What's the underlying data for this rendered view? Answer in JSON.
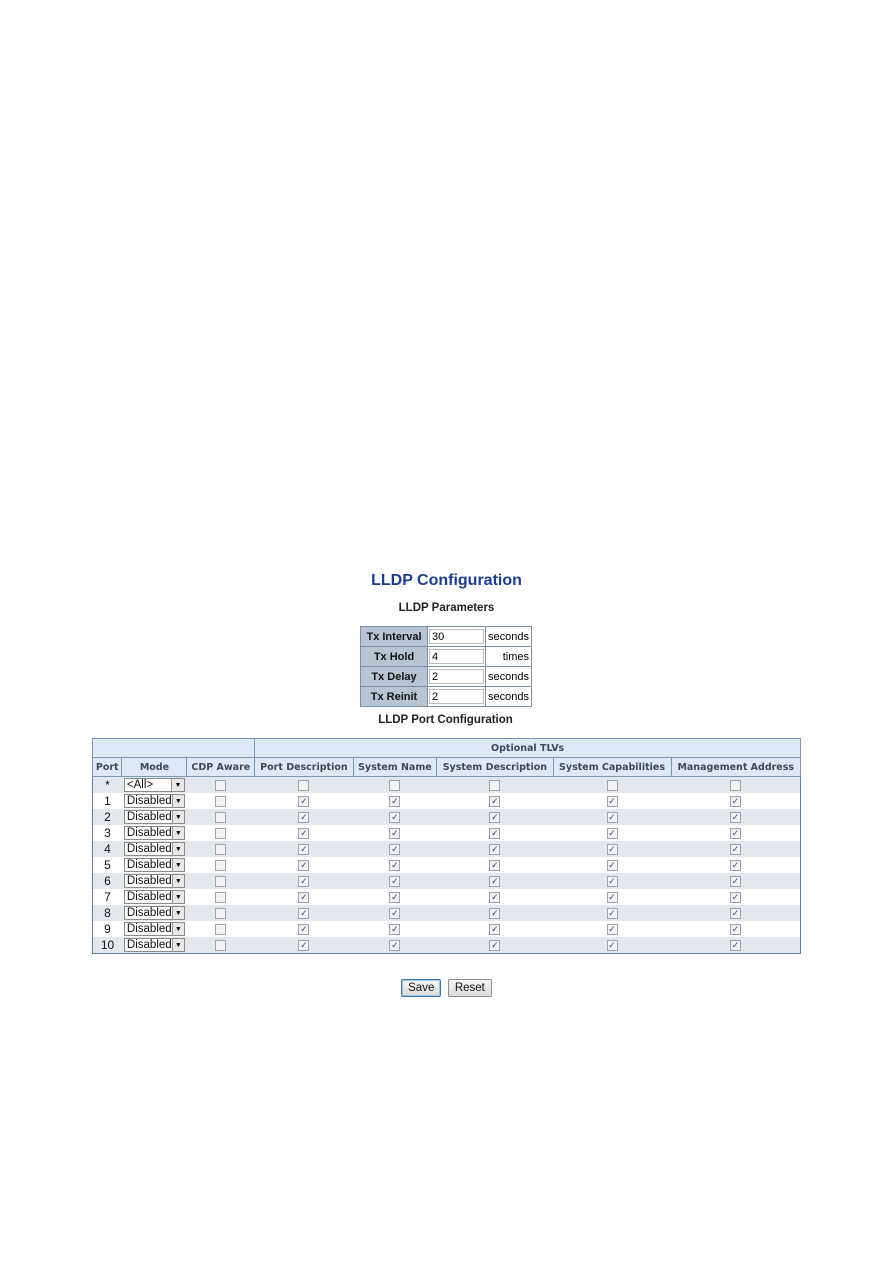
{
  "page_title": "LLDP Configuration",
  "parameters": {
    "title": "LLDP Parameters",
    "rows": [
      {
        "label": "Tx Interval",
        "value": "30",
        "unit": "seconds"
      },
      {
        "label": "Tx Hold",
        "value": "4",
        "unit": "times"
      },
      {
        "label": "Tx Delay",
        "value": "2",
        "unit": "seconds"
      },
      {
        "label": "Tx Reinit",
        "value": "2",
        "unit": "seconds"
      }
    ]
  },
  "port_config": {
    "title": "LLDP Port Configuration",
    "group_header": "Optional TLVs",
    "columns": [
      "Port",
      "Mode",
      "CDP Aware",
      "Port Description",
      "System Name",
      "System Description",
      "System Capabilities",
      "Management Address"
    ],
    "all_row": {
      "port": "*",
      "mode": "<All>",
      "cdp_aware": false,
      "port_description": false,
      "system_name": false,
      "system_description": false,
      "system_capabilities": false,
      "management_address": false
    },
    "rows": [
      {
        "port": "1",
        "mode": "Disabled",
        "cdp_aware": false,
        "port_description": true,
        "system_name": true,
        "system_description": true,
        "system_capabilities": true,
        "management_address": true
      },
      {
        "port": "2",
        "mode": "Disabled",
        "cdp_aware": false,
        "port_description": true,
        "system_name": true,
        "system_description": true,
        "system_capabilities": true,
        "management_address": true
      },
      {
        "port": "3",
        "mode": "Disabled",
        "cdp_aware": false,
        "port_description": true,
        "system_name": true,
        "system_description": true,
        "system_capabilities": true,
        "management_address": true
      },
      {
        "port": "4",
        "mode": "Disabled",
        "cdp_aware": false,
        "port_description": true,
        "system_name": true,
        "system_description": true,
        "system_capabilities": true,
        "management_address": true
      },
      {
        "port": "5",
        "mode": "Disabled",
        "cdp_aware": false,
        "port_description": true,
        "system_name": true,
        "system_description": true,
        "system_capabilities": true,
        "management_address": true
      },
      {
        "port": "6",
        "mode": "Disabled",
        "cdp_aware": false,
        "port_description": true,
        "system_name": true,
        "system_description": true,
        "system_capabilities": true,
        "management_address": true
      },
      {
        "port": "7",
        "mode": "Disabled",
        "cdp_aware": false,
        "port_description": true,
        "system_name": true,
        "system_description": true,
        "system_capabilities": true,
        "management_address": true
      },
      {
        "port": "8",
        "mode": "Disabled",
        "cdp_aware": false,
        "port_description": true,
        "system_name": true,
        "system_description": true,
        "system_capabilities": true,
        "management_address": true
      },
      {
        "port": "9",
        "mode": "Disabled",
        "cdp_aware": false,
        "port_description": true,
        "system_name": true,
        "system_description": true,
        "system_capabilities": true,
        "management_address": true
      },
      {
        "port": "10",
        "mode": "Disabled",
        "cdp_aware": false,
        "port_description": true,
        "system_name": true,
        "system_description": true,
        "system_capabilities": true,
        "management_address": true
      }
    ]
  },
  "buttons": {
    "save": "Save",
    "reset": "Reset"
  },
  "icons": {
    "dropdown_arrow": "▼",
    "checkmark": "✓"
  }
}
